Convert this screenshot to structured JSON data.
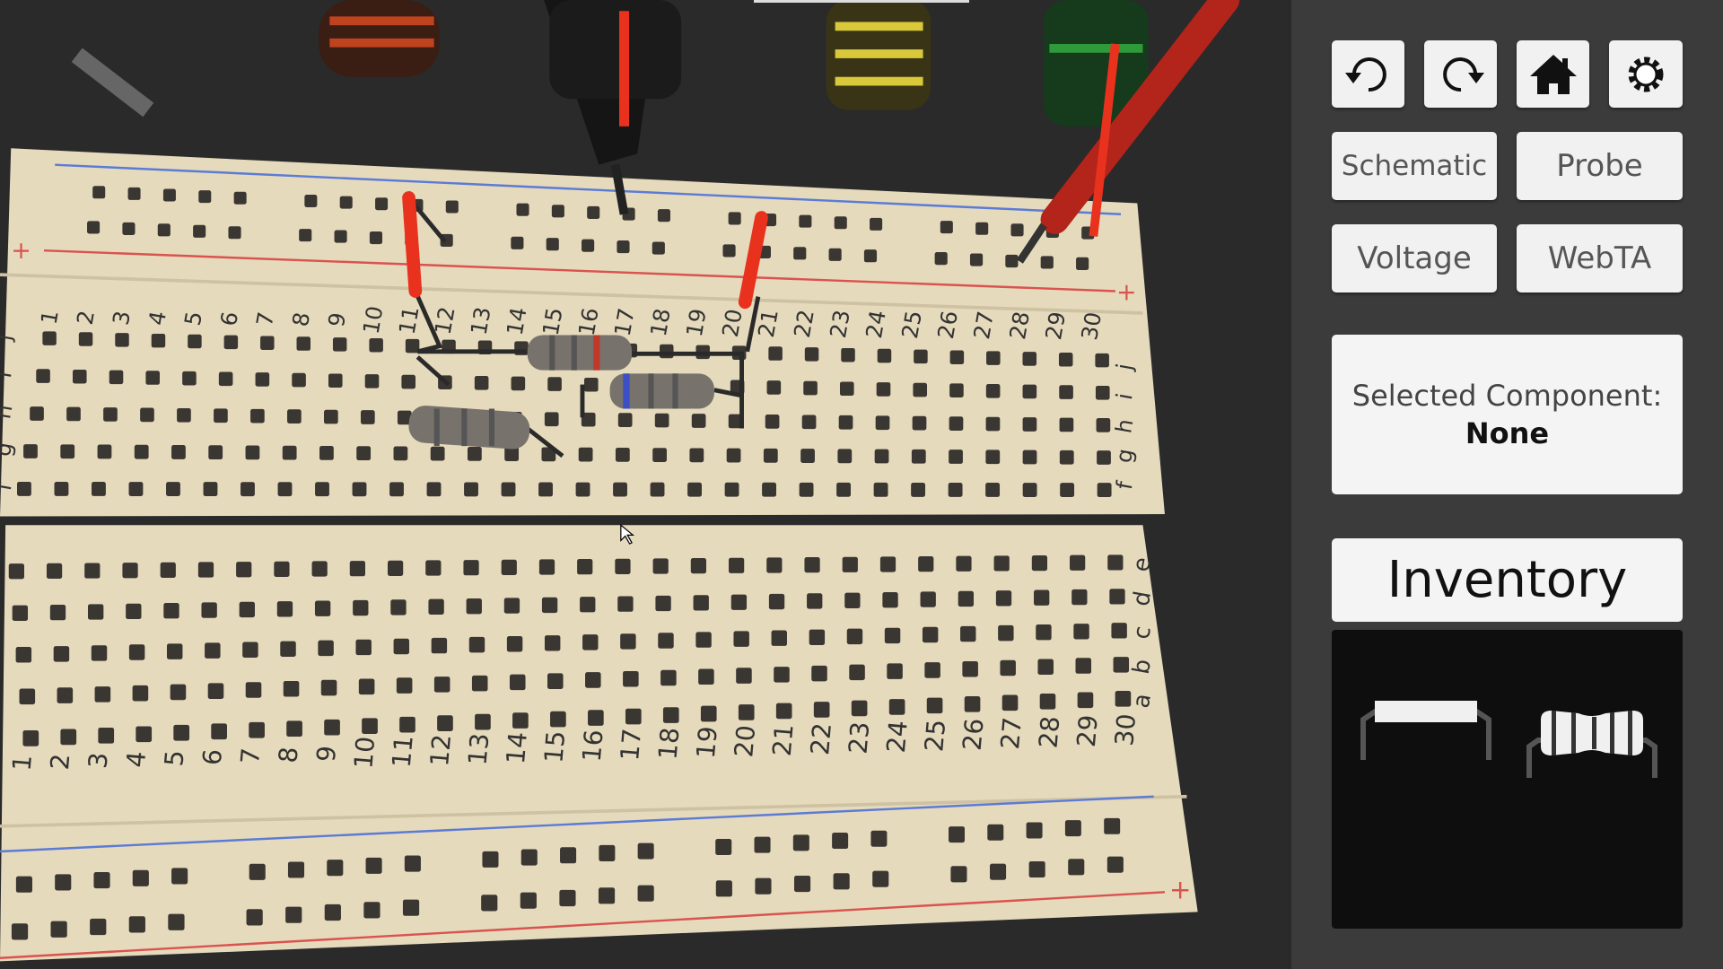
{
  "toolbar": {
    "undo": {
      "icon": "undo-icon"
    },
    "redo": {
      "icon": "redo-icon"
    },
    "home": {
      "icon": "home-icon"
    },
    "settings": {
      "icon": "gear-icon"
    },
    "schematic_label": "Schematic",
    "probe_label": "Probe",
    "voltage_label": "Voltage",
    "webta_label": "WebTA"
  },
  "selected": {
    "label": "Selected Component:",
    "value": "None"
  },
  "inventory": {
    "label": "Inventory",
    "items": [
      {
        "icon": "wire-icon"
      },
      {
        "icon": "resistor-icon"
      }
    ]
  },
  "breadboard": {
    "columns": [
      "1",
      "2",
      "3",
      "4",
      "5",
      "6",
      "7",
      "8",
      "9",
      "10",
      "11",
      "12",
      "13",
      "14",
      "15",
      "16",
      "17",
      "18",
      "19",
      "20",
      "21",
      "22",
      "23",
      "24",
      "25",
      "26",
      "27",
      "28",
      "29",
      "30"
    ],
    "top_rows": [
      "j",
      "i",
      "h",
      "g",
      "f"
    ],
    "bottom_rows": [
      "e",
      "d",
      "c",
      "b",
      "a"
    ],
    "rail_plus": "+",
    "rail_minus": "-"
  },
  "colors": {
    "board": "#e8dcc0",
    "hole": "#3a3632",
    "wire": "#e8321e",
    "rail_red": "#d9534f",
    "rail_blue": "#5b7bd5"
  }
}
